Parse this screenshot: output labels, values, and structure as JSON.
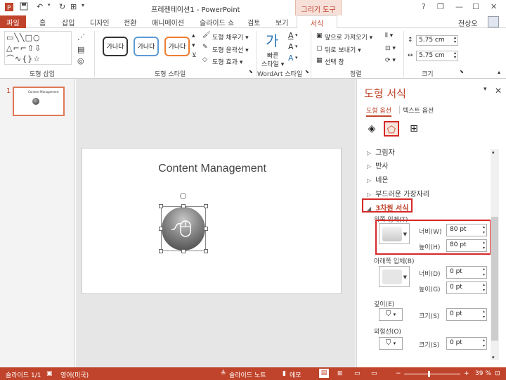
{
  "titlebar": {
    "title": "프레젠테이션1 - PowerPoint",
    "contextual_tab_group": "그리기 도구",
    "help": "?",
    "restore_icon_glyph": "❐",
    "minimize": "—",
    "maximize": "☐",
    "close": "✕"
  },
  "tabs": {
    "file": "파일",
    "items": [
      "홈",
      "삽입",
      "디자인",
      "전환",
      "애니메이션",
      "슬라이드 쇼",
      "검토",
      "보기"
    ],
    "format": "서식",
    "user": "전상오"
  },
  "ribbon": {
    "insert_shapes": {
      "label": "도형 삽입",
      "gallery": "▭╲╲□○\n△⌐⌐⇧⇩\n⌒∿{}☆"
    },
    "shape_styles": {
      "label": "도형 스타일",
      "style1": "가나다",
      "style2": "가나다",
      "style3": "가나다",
      "fill": "도형 채우기 ▾",
      "outline": "도형 윤곽선 ▾",
      "effects": "도형 효과 ▾"
    },
    "wordart": {
      "label": "WordArt 스타일",
      "quick_styles_line1": "빠른",
      "quick_styles_line2": "스타일 ▾",
      "glyph": "가"
    },
    "arrange": {
      "label": "정렬",
      "bring_forward": "앞으로 가져오기 ▾",
      "send_backward": "뒤로 보내기 ▾",
      "selection_pane": "선택 창"
    },
    "size": {
      "label": "크기",
      "height": "5.75 cm",
      "width": "5.75 cm"
    }
  },
  "thumbnails": {
    "slide_number": "1",
    "thumb_title": "Content Management"
  },
  "slide": {
    "title": "Content Management"
  },
  "format_pane": {
    "title": "도형 서식",
    "tab_shape_options": "도형 옵션",
    "tab_text_options": "텍스트 옵션",
    "sections": [
      "그림자",
      "반사",
      "네온",
      "부드러운 가장자리"
    ],
    "section_3d": "3차원 서식",
    "top_bevel": "위쪽 입체(T)",
    "top_width_label": "너비(W)",
    "top_width_value": "80 pt",
    "top_height_label": "높이(H)",
    "top_height_value": "80 pt",
    "bottom_bevel": "아래쪽 입체(B)",
    "bottom_width_label": "너비(D)",
    "bottom_width_value": "0 pt",
    "bottom_height_label": "높이(G)",
    "bottom_height_value": "0 pt",
    "depth": "깊이(E)",
    "depth_size_label": "크기(S)",
    "depth_size_value": "0 pt",
    "contour": "외형선(O)",
    "contour_size_label": "크기(S)",
    "contour_size_value": "0 pt"
  },
  "status": {
    "slide": "슬라이드 1/1",
    "language": "영어(미국)",
    "notes": "슬라이드 노트",
    "comments": "메모",
    "zoom": "39 %"
  },
  "colors": {
    "accent": "#c0442b",
    "highlight": "#d62828"
  }
}
